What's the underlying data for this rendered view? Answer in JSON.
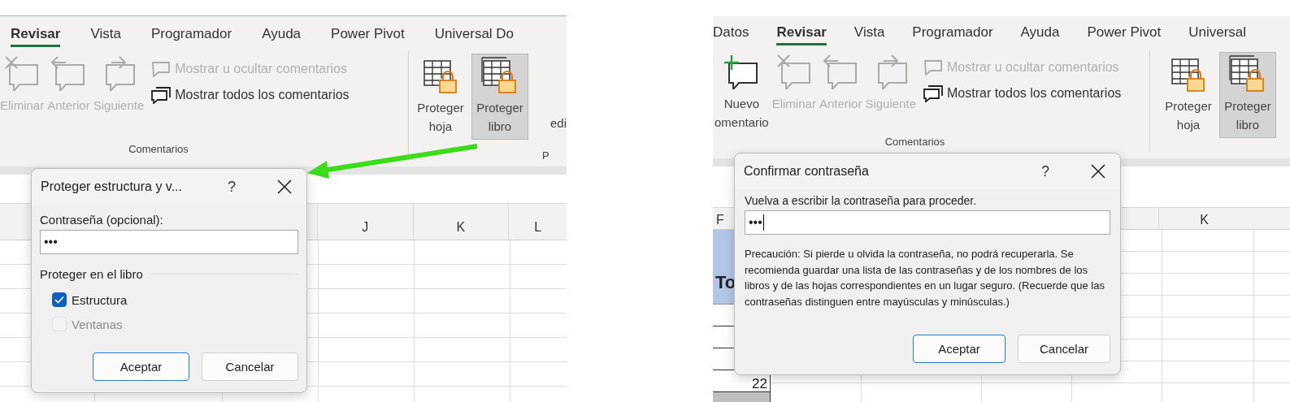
{
  "panels": [
    {
      "tabs": [
        {
          "label": "Revisar",
          "selected": true
        },
        {
          "label": "Vista",
          "selected": false
        },
        {
          "label": "Programador",
          "selected": false
        },
        {
          "label": "Ayuda",
          "selected": false
        },
        {
          "label": "Power Pivot",
          "selected": false
        },
        {
          "label": "Universal Do",
          "selected": false
        }
      ],
      "comment_buttons": [
        {
          "kind": "delete",
          "label": "Eliminar",
          "disabled": true
        },
        {
          "kind": "previous",
          "label": "Anterior",
          "disabled": true
        },
        {
          "kind": "next",
          "label": "Siguiente",
          "disabled": true
        }
      ],
      "comment_toggles": [
        {
          "kind": "single",
          "label": "Mostrar u ocultar comentarios",
          "disabled": true
        },
        {
          "kind": "all",
          "label": "Mostrar todos los comentarios",
          "disabled": false
        }
      ],
      "group_label": "Comentarios",
      "protect_buttons": [
        {
          "kind": "sheet",
          "label": "Proteger\nhoja",
          "selected": false
        },
        {
          "kind": "workbook",
          "label": "Proteger\nlibro",
          "selected": true
        }
      ],
      "cut_button_label": "edi",
      "cut_group_label": "P",
      "column_headers": [
        {
          "label": "J"
        },
        {
          "label": "K"
        },
        {
          "label": "L"
        }
      ],
      "arrow": true,
      "dialog": {
        "kind": "protect",
        "title": "Proteger estructura y v...",
        "help_glyph": "?",
        "password_label": "Contraseña (opcional):",
        "password_value": "•••",
        "group_title": "Proteger en el libro",
        "checkboxes": [
          {
            "label": "Estructura",
            "checked": true,
            "disabled": false
          },
          {
            "label": "Ventanas",
            "checked": false,
            "disabled": true
          }
        ],
        "buttons": [
          {
            "label": "Aceptar",
            "default": true
          },
          {
            "label": "Cancelar",
            "default": false
          }
        ]
      }
    },
    {
      "tabs": [
        {
          "label": "Datos",
          "selected": false
        },
        {
          "label": "Revisar",
          "selected": true
        },
        {
          "label": "Vista",
          "selected": false
        },
        {
          "label": "Programador",
          "selected": false
        },
        {
          "label": "Ayuda",
          "selected": false
        },
        {
          "label": "Power Pivot",
          "selected": false
        },
        {
          "label": "Universal",
          "selected": false
        }
      ],
      "comment_buttons": [
        {
          "kind": "new",
          "label": "Nuevo\nomentario",
          "disabled": false
        },
        {
          "kind": "delete",
          "label": "Eliminar",
          "disabled": true
        },
        {
          "kind": "previous",
          "label": "Anterior",
          "disabled": true
        },
        {
          "kind": "next",
          "label": "Siguiente",
          "disabled": true
        }
      ],
      "comment_toggles": [
        {
          "kind": "single",
          "label": "Mostrar u ocultar comentarios",
          "disabled": true
        },
        {
          "kind": "all",
          "label": "Mostrar todos los comentarios",
          "disabled": false
        }
      ],
      "group_label": "Comentarios",
      "protect_buttons": [
        {
          "kind": "sheet",
          "label": "Proteger\nhoja",
          "selected": false
        },
        {
          "kind": "workbook",
          "label": "Proteger\nlibro",
          "selected": true
        }
      ],
      "column_headers": [
        {
          "label": "F"
        },
        {
          "label": "K"
        }
      ],
      "cells": [
        {
          "kind": "fill",
          "text": "To"
        },
        {
          "kind": "boxed"
        },
        {
          "kind": "boxed"
        },
        {
          "kind": "boxed"
        },
        {
          "kind": "boxed",
          "text": "22"
        },
        {
          "kind": "total"
        }
      ],
      "dialog": {
        "kind": "confirm",
        "title": "Confirmar contraseña",
        "help_glyph": "?",
        "password_label": "Vuelva a escribir la contraseña para proceder.",
        "password_value": "•••",
        "focused": true,
        "warning": "Precaución: Si pierde u olvida la contraseña, no podrá recuperarla. Se recomienda guardar una lista de las contraseñas y de los nombres de los libros y de las hojas correspondientes en un lugar seguro. (Recuerde que las contraseñas distinguen entre mayúsculas y minúsculas.)",
        "buttons": [
          {
            "label": "Aceptar",
            "default": true
          },
          {
            "label": "Cancelar",
            "default": false
          }
        ]
      }
    }
  ]
}
